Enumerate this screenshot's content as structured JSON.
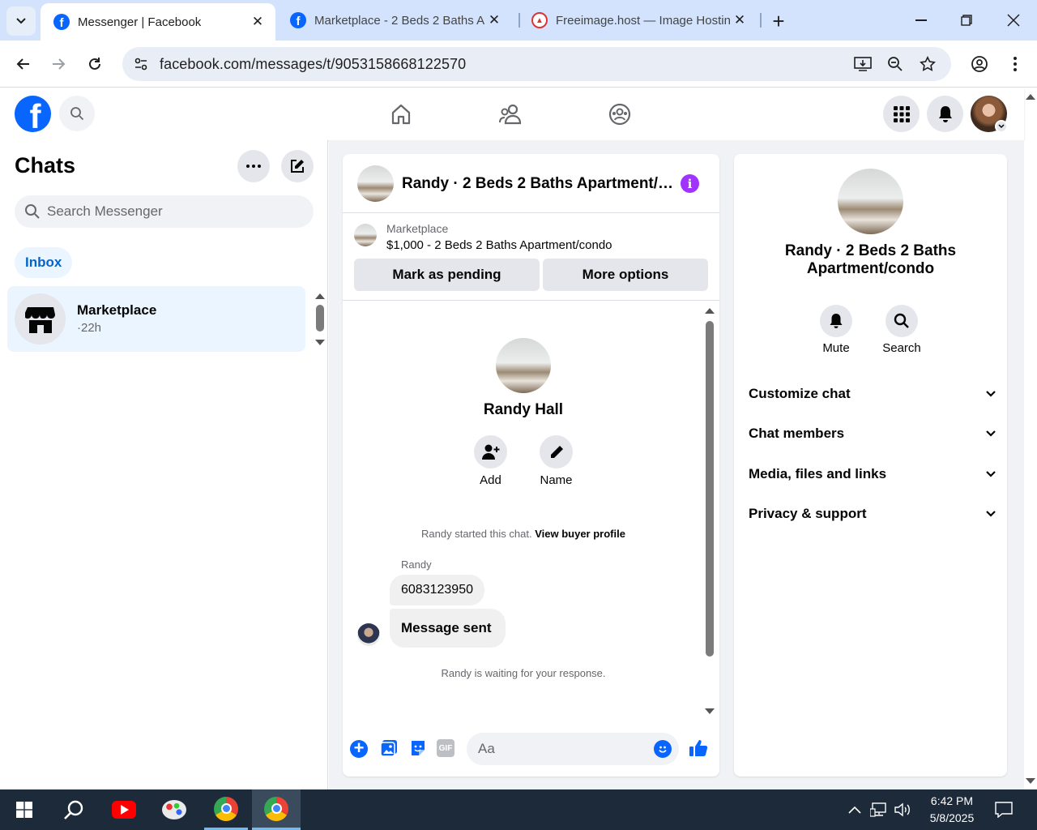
{
  "browser": {
    "tabs": [
      {
        "title": "Messenger | Facebook",
        "active": true
      },
      {
        "title": "Marketplace - 2 Beds 2 Baths Apartment/condo",
        "active": false
      },
      {
        "title": "Freeimage.host — Image Hosting",
        "active": false
      }
    ],
    "new_tab": "+",
    "url": "facebook.com/messages/t/9053158668122570"
  },
  "header": {
    "logo_letter": "f"
  },
  "chats": {
    "title": "Chats",
    "search_placeholder": "Search Messenger",
    "filter_tab": "Inbox",
    "items": [
      {
        "name": "Marketplace",
        "meta": "·22h"
      }
    ]
  },
  "conversation": {
    "header_title": "Randy · 2 Beds 2 Baths Apartment/…",
    "listing_source": "Marketplace",
    "listing_title": "$1,000 - 2 Beds 2 Baths Apartment/condo",
    "mark_pending": "Mark as pending",
    "more_options": "More options",
    "profile_name": "Randy Hall",
    "add_label": "Add",
    "name_label": "Name",
    "started_text": "Randy started this chat.",
    "view_buyer": "View buyer profile",
    "sender": "Randy",
    "messages": [
      "6083123950",
      "Message sent"
    ],
    "waiting_text": "Randy is waiting for your response.",
    "composer_placeholder": "Aa",
    "gif_label": "GIF"
  },
  "details": {
    "name": "Randy · 2 Beds 2 Baths Apartment/condo",
    "mute_label": "Mute",
    "search_label": "Search",
    "sections": [
      "Customize chat",
      "Chat members",
      "Media, files and links",
      "Privacy & support"
    ]
  },
  "taskbar": {
    "time": "6:42 PM",
    "date": "5/8/2025"
  },
  "colors": {
    "fb_blue": "#0866ff",
    "purple_info": "#a033ff",
    "inbox_bg": "#ebf5ff",
    "taskbar": "#1c2a39"
  }
}
